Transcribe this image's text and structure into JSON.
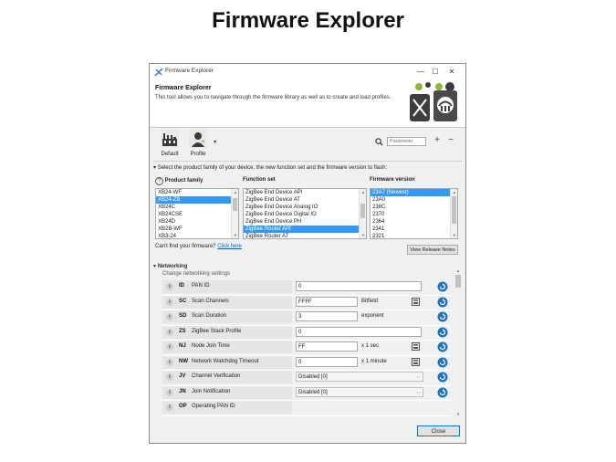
{
  "slide": {
    "title": "Firmware Explorer"
  },
  "window": {
    "title": "Firmware Explorer",
    "minimize": "—",
    "maximize": "☐",
    "close": "✕"
  },
  "header": {
    "title": "Firmware Explorer",
    "description": "This tool allows you to navigate through the firmware library as well as to create and load profiles."
  },
  "toolbar": {
    "default_label": "Default",
    "profile_label": "Profile",
    "dropdown_arrow": "▾",
    "search_placeholder": "Parameter",
    "expand_icon": "+",
    "collapse_icon": "−"
  },
  "selector": {
    "instruction": "Select the product family of your device, the new function set and the firmware version to flash:",
    "product_family": {
      "header": "Product family",
      "items": [
        "XB24-WF",
        "XB24-ZB",
        "XB24C",
        "XB24CSE",
        "XB24D",
        "XB2B-WF",
        "XB3-24"
      ],
      "selected_index": 1
    },
    "function_set": {
      "header": "Function set",
      "items": [
        "ZigBee End Device API",
        "ZigBee End Device AT",
        "ZigBee End Device Analog IO",
        "ZigBee End Device Digital IO",
        "ZigBee End Device PH",
        "ZigBee Router API",
        "ZigBee Router AT"
      ],
      "selected_index": 5
    },
    "firmware_version": {
      "header": "Firmware version",
      "items": [
        "23A7 (Newest)",
        "23A0",
        "238C",
        "2370",
        "2364",
        "2341",
        "2321"
      ],
      "selected_index": 0
    },
    "cant_find": "Can't find your firmware?",
    "click_here": "Click here",
    "release_notes_button": "View Release Notes"
  },
  "networking": {
    "section_title": "Networking",
    "section_subtitle": "Change networking settings",
    "rows": [
      {
        "cmd": "ID",
        "name": "PAN ID",
        "value": "0",
        "unit": "",
        "kind": "text"
      },
      {
        "cmd": "SC",
        "name": "Scan Channels",
        "value": "FFFF",
        "unit": "Bitfield",
        "kind": "text-edit"
      },
      {
        "cmd": "SD",
        "name": "Scan Duration",
        "value": "3",
        "unit": "exponent",
        "kind": "text"
      },
      {
        "cmd": "ZS",
        "name": "ZigBee Stack Profile",
        "value": "0",
        "unit": "",
        "kind": "text"
      },
      {
        "cmd": "NJ",
        "name": "Node Join Time",
        "value": "FF",
        "unit": "x 1 sec",
        "kind": "text-edit"
      },
      {
        "cmd": "NW",
        "name": "Network Watchdog Timeout",
        "value": "0",
        "unit": "x 1 minute",
        "kind": "text-edit"
      },
      {
        "cmd": "JV",
        "name": "Channel Verification",
        "value": "Disabled [0]",
        "unit": "",
        "kind": "dropdown"
      },
      {
        "cmd": "JN",
        "name": "Join Notification",
        "value": "Disabled [0]",
        "unit": "",
        "kind": "dropdown"
      },
      {
        "cmd": "OP",
        "name": "Operating PAN ID",
        "value": "",
        "unit": "",
        "kind": "readonly"
      }
    ]
  },
  "footer": {
    "close_button": "Close"
  },
  "colors": {
    "selection": "#3399ff",
    "link": "#0066cc",
    "refresh": "#1a73c8"
  }
}
